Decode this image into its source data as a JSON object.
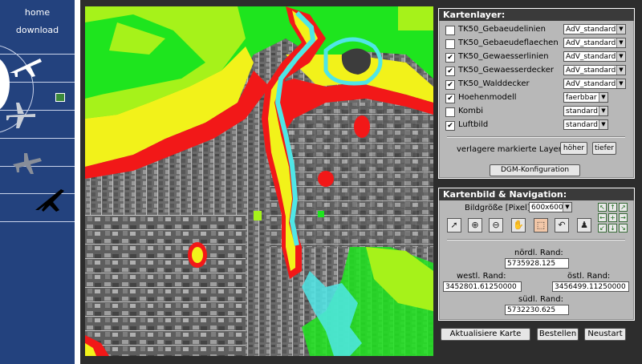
{
  "sidebar": {
    "home_label": "home",
    "download_label": "download"
  },
  "layers_panel": {
    "title": "Kartenlayer:",
    "layers": [
      {
        "name": "TK50_Gebaeudelinien",
        "checked": false,
        "style": "AdV_standard"
      },
      {
        "name": "TK50_Gebaeudeflaechen",
        "checked": false,
        "style": "AdV_standard"
      },
      {
        "name": "TK50_Gewaesserlinien",
        "checked": true,
        "style": "AdV_standard"
      },
      {
        "name": "TK50_Gewaesserdecker",
        "checked": true,
        "style": "AdV_standard"
      },
      {
        "name": "TK50_Walddecker",
        "checked": true,
        "style": "AdV_standard"
      },
      {
        "name": "Hoehenmodell",
        "checked": true,
        "style": "faerbbar"
      },
      {
        "name": "Kombi",
        "checked": false,
        "style": "standard"
      },
      {
        "name": "Luftbild",
        "checked": true,
        "style": "standard"
      }
    ],
    "move_label": "verlagere markierte Layer:",
    "higher_button": "höher",
    "lower_button": "tiefer",
    "dgm_button": "DGM-Konfiguration"
  },
  "nav_panel": {
    "title": "Kartenbild & Navigation:",
    "size_label": "Bildgröße [Pixel]:",
    "size_value": "600x600",
    "north_label": "nördl. Rand:",
    "north_value": "5735928.125",
    "west_label": "westl. Rand:",
    "west_value": "3452801.61250000",
    "east_label": "östl. Rand:",
    "east_value": "3456499.11250000",
    "south_label": "südl. Rand:",
    "south_value": "5732230.625"
  },
  "bottom_buttons": {
    "update": "Aktualisiere Karte",
    "order": "Bestellen",
    "restart": "Neustart"
  },
  "colors": {
    "sidebar": "#23427e",
    "map_high": "#1ee51e",
    "map_mid": "#a6f21a",
    "map_yellow": "#f2f21a",
    "map_red": "#f21818",
    "water": "#4fe6e6",
    "panel_title": "#3a3a3a"
  }
}
